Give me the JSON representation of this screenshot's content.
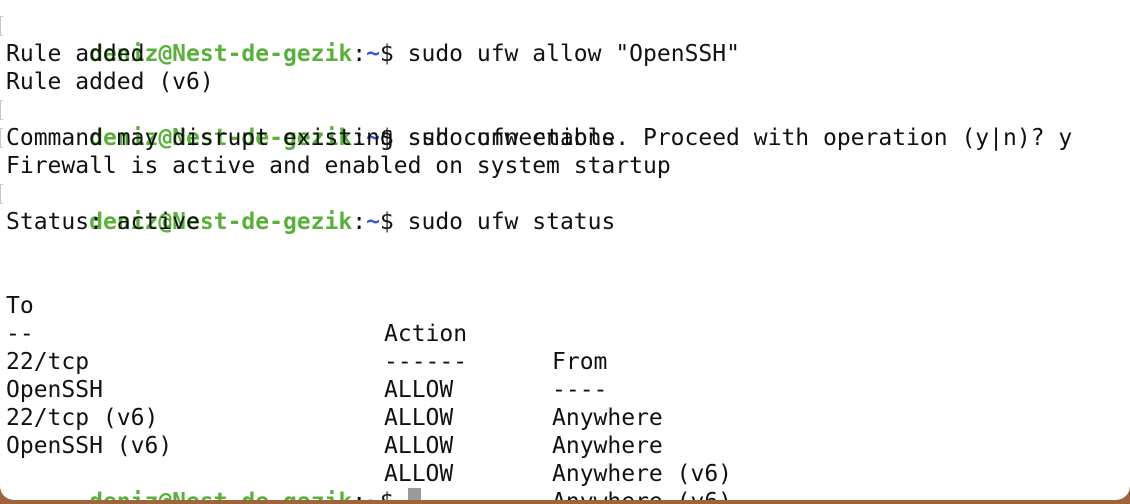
{
  "prompt": {
    "user_host": "deniz@Nest-de-gezik",
    "colon": ":",
    "path": "~",
    "symbol": "$"
  },
  "lines": [
    {
      "command": " sudo ufw allow \"OpenSSH\""
    },
    {
      "output": "Rule added"
    },
    {
      "output": "Rule added (v6)"
    },
    {
      "command": " sudo ufw enable"
    },
    {
      "output": "Command may disrupt existing ssh connections. Proceed with operation (y|n)? y"
    },
    {
      "output": "Firewall is active and enabled on system startup"
    },
    {
      "command": " sudo ufw status"
    },
    {
      "output": "Status: active"
    }
  ],
  "table": {
    "headers": [
      "To",
      "Action",
      "From"
    ],
    "underlines": [
      "--",
      "------",
      "----"
    ],
    "rows": [
      [
        "22/tcp",
        "ALLOW",
        "Anywhere"
      ],
      [
        "OpenSSH",
        "ALLOW",
        "Anywhere"
      ],
      [
        "22/tcp (v6)",
        "ALLOW",
        "Anywhere (v6)"
      ],
      [
        "OpenSSH (v6)",
        "ALLOW",
        "Anywhere (v6)"
      ]
    ]
  }
}
